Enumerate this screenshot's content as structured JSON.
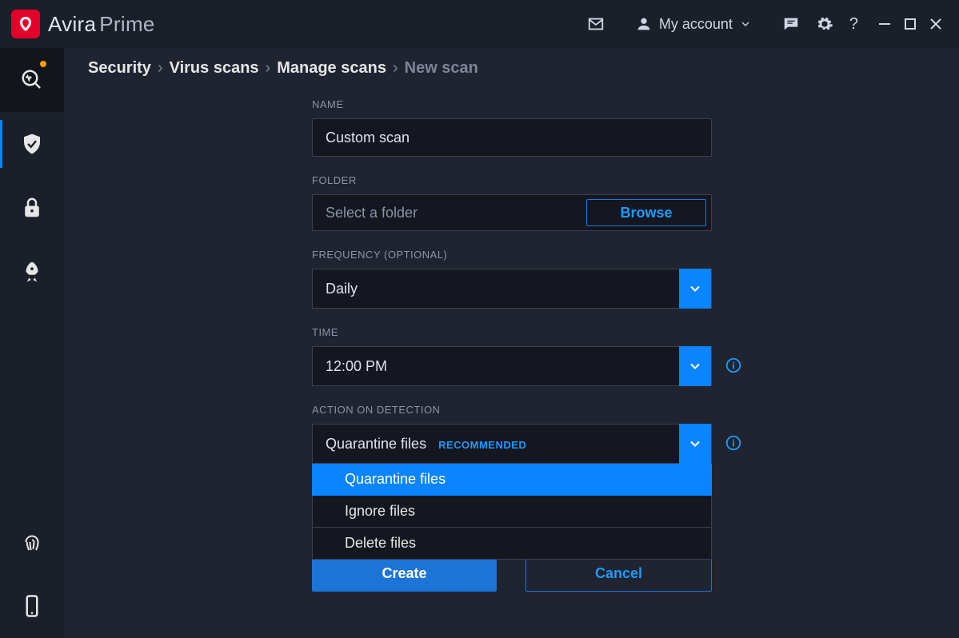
{
  "brand": {
    "name": "Avira",
    "suffix": "Prime"
  },
  "titlebar": {
    "account_label": "My account"
  },
  "sidebar": {
    "items": [
      {
        "name": "status"
      },
      {
        "name": "security"
      },
      {
        "name": "privacy"
      },
      {
        "name": "performance"
      }
    ],
    "bottom": [
      {
        "name": "fingerprint"
      },
      {
        "name": "mobile"
      }
    ]
  },
  "breadcrumb": {
    "items": [
      "Security",
      "Virus scans",
      "Manage scans"
    ],
    "current": "New scan"
  },
  "form": {
    "name_label": "NAME",
    "name_value": "Custom scan",
    "folder_label": "FOLDER",
    "folder_placeholder": "Select a folder",
    "browse_label": "Browse",
    "frequency_label": "FREQUENCY (OPTIONAL)",
    "frequency_value": "Daily",
    "time_label": "TIME",
    "time_value": "12:00 PM",
    "action_label": "ACTION ON DETECTION",
    "action_value": "Quarantine files",
    "action_recommended": "RECOMMENDED",
    "action_options": [
      "Quarantine files",
      "Ignore files",
      "Delete files"
    ],
    "create_label": "Create",
    "cancel_label": "Cancel"
  }
}
